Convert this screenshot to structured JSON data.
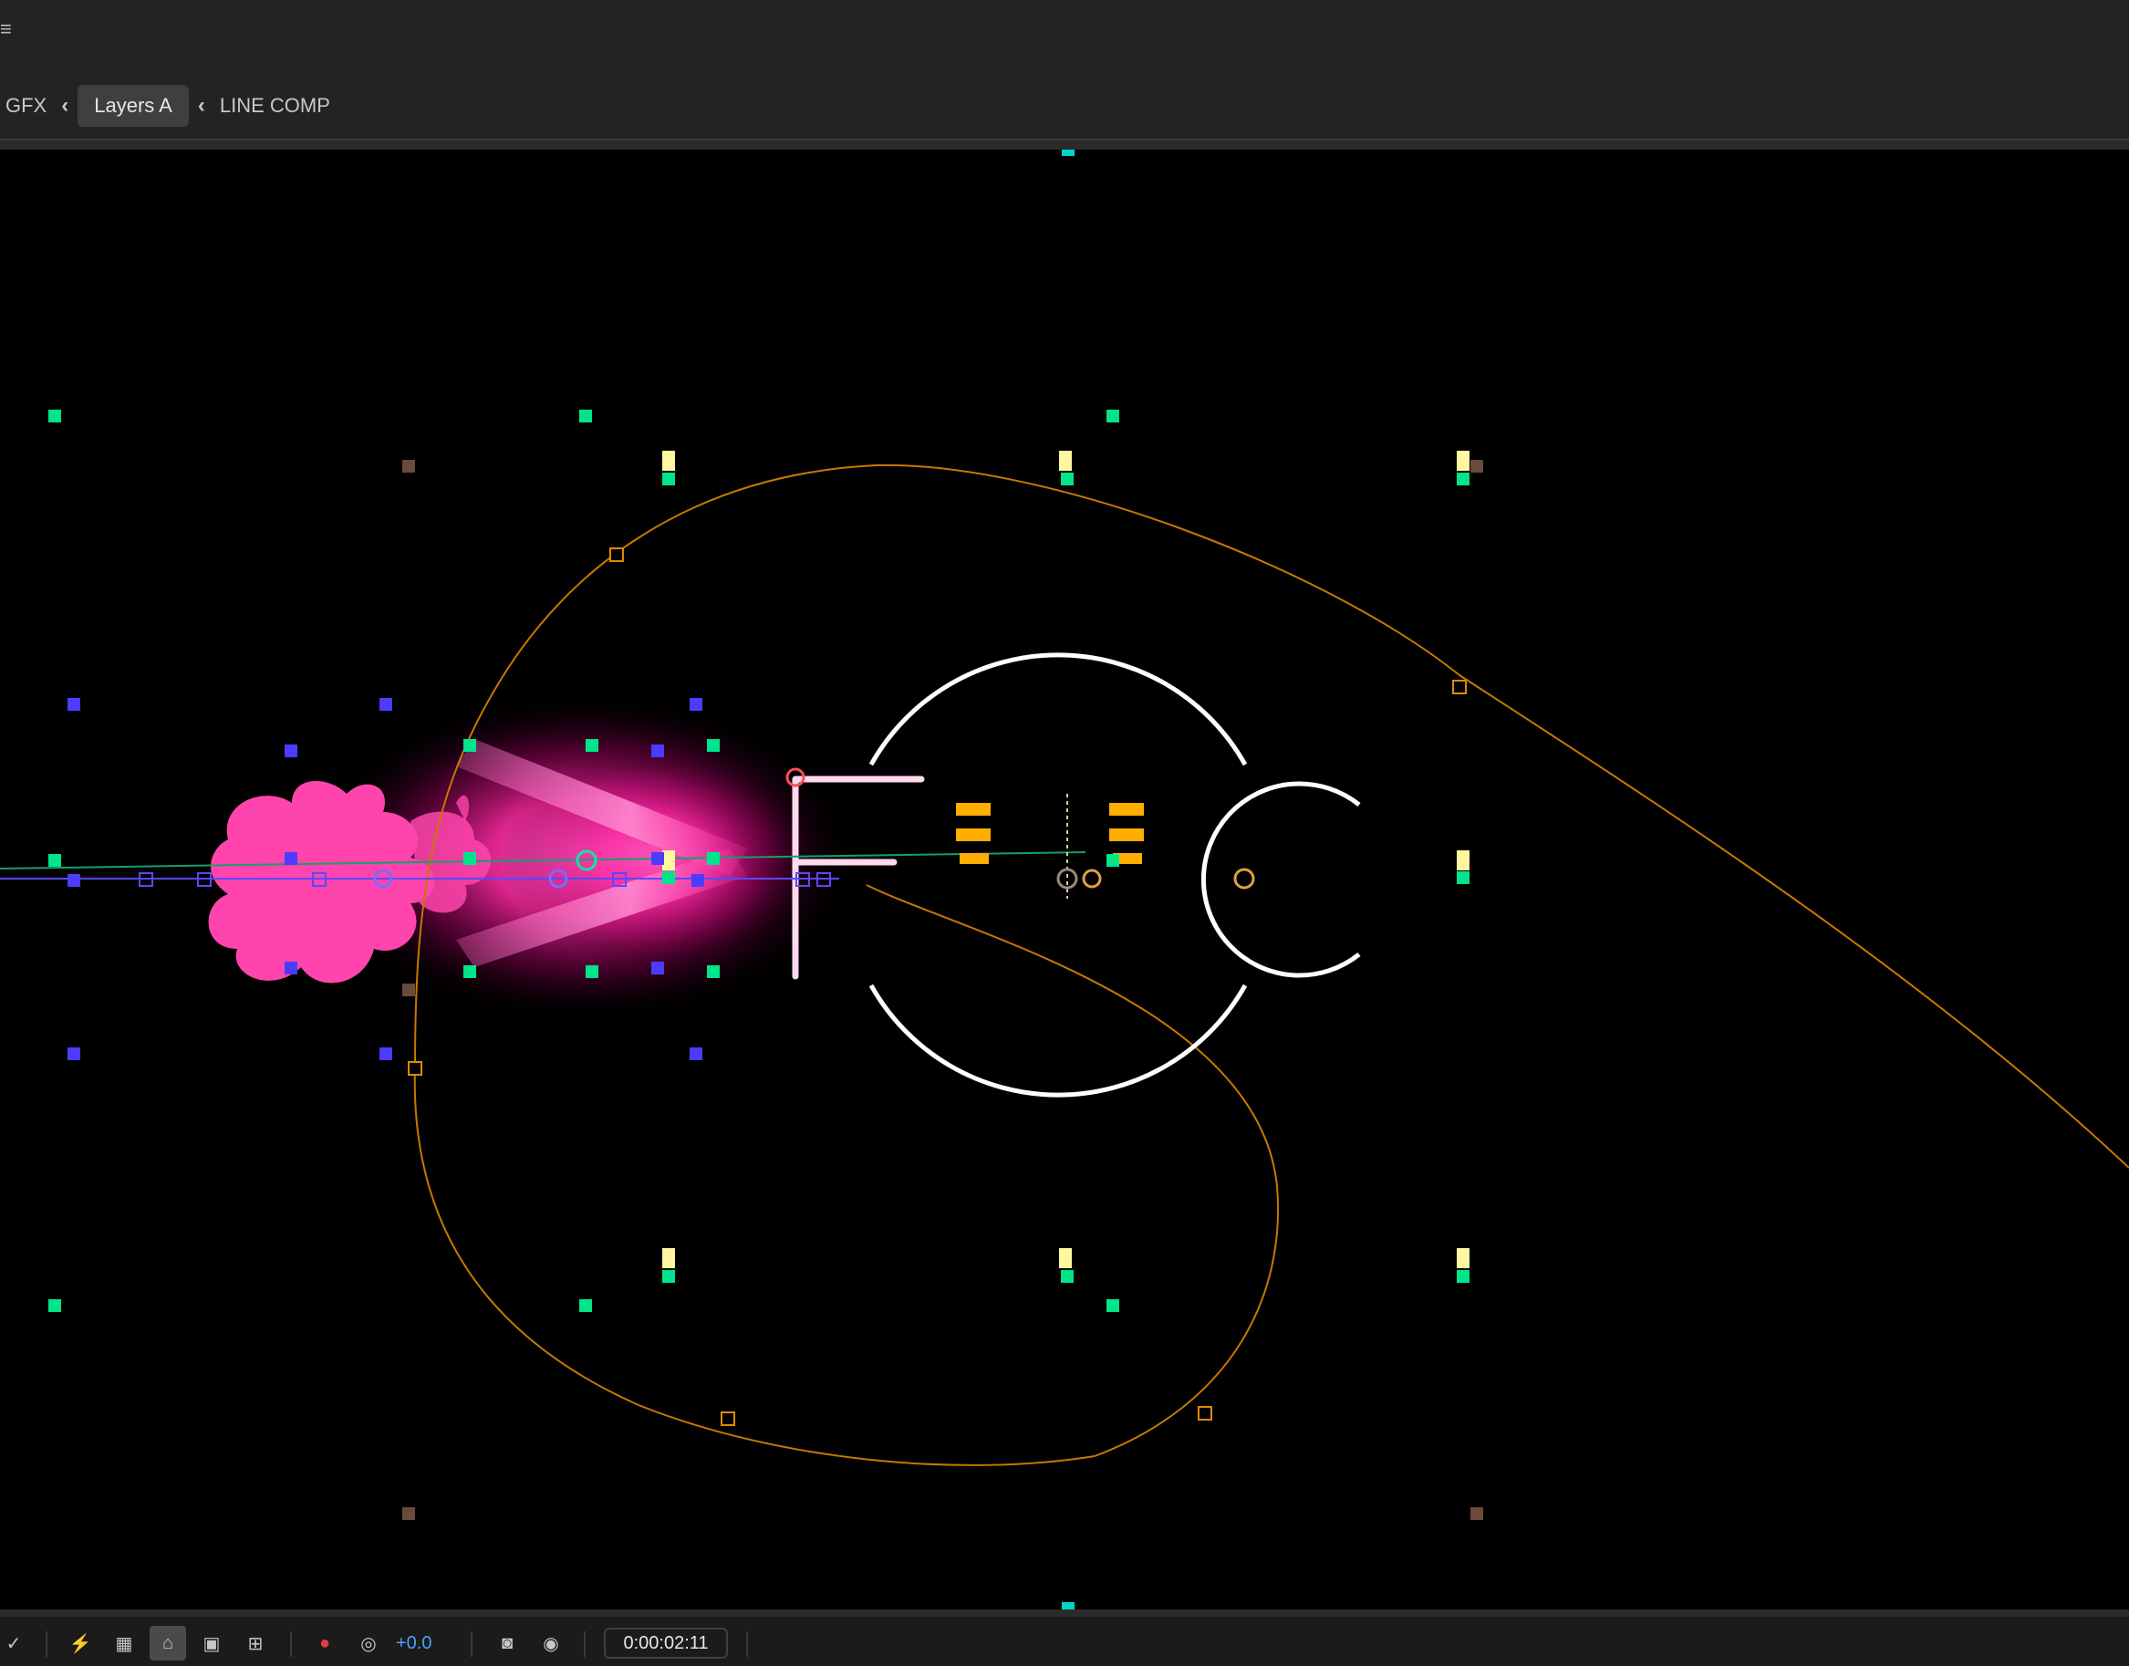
{
  "breadcrumbs": {
    "items": [
      "GFX",
      "Layers A",
      "LINE COMP"
    ],
    "active": "Layers A"
  },
  "toolbar": {
    "exposure_value": "+0.0",
    "timecode": "0:00:02:11",
    "icons": [
      "checkbox-icon",
      "fast-previews-icon",
      "transparency-grid-icon",
      "mask-path-visibility-icon",
      "region-of-interest-icon",
      "toggle-guides-icon",
      "color-channels-icon",
      "color-management-icon",
      "camera-snapshot-icon",
      "show-snapshot-icon"
    ]
  },
  "colors": {
    "accent_blue": "#4aa0ff",
    "motion_path_orange": "#e08a00",
    "glow_pink": "#ff2aa3",
    "marker_green": "#00e58a",
    "marker_blue": "#4b3cff",
    "marker_yellow": "#fff7a0",
    "marker_cyan": "#00d6c8",
    "marker_brown": "#6a4a3a"
  }
}
